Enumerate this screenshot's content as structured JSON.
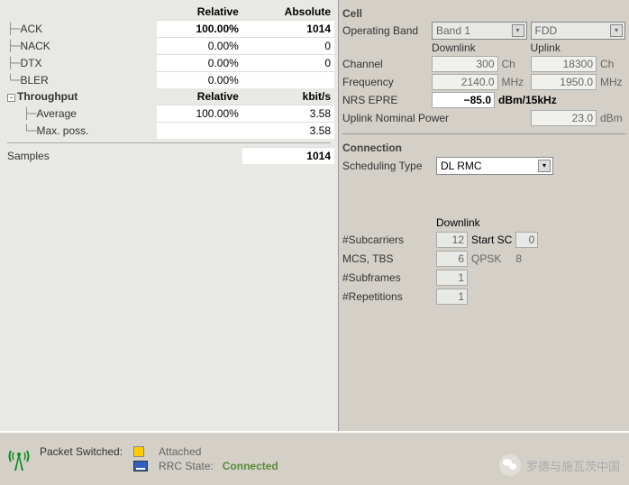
{
  "left": {
    "headers": {
      "relative": "Relative",
      "absolute": "Absolute"
    },
    "rows": {
      "ack": {
        "label": "ACK",
        "rel": "100.00%",
        "abs": "1014"
      },
      "nack": {
        "label": "NACK",
        "rel": "0.00%",
        "abs": "0"
      },
      "dtx": {
        "label": "DTX",
        "rel": "0.00%",
        "abs": "0"
      },
      "bler": {
        "label": "BLER",
        "rel": "0.00%"
      }
    },
    "throughput": {
      "label": "Throughput",
      "headers": {
        "relative": "Relative",
        "unit": "kbit/s"
      },
      "average": {
        "label": "Average",
        "rel": "100.00%",
        "val": "3.58"
      },
      "maxposs": {
        "label": "Max. poss.",
        "val": "3.58"
      }
    },
    "samples": {
      "label": "Samples",
      "val": "1014"
    }
  },
  "cell": {
    "title": "Cell",
    "operating_band": {
      "label": "Operating Band",
      "band": "Band 1",
      "duplex": "FDD"
    },
    "col_headers": {
      "dl": "Downlink",
      "ul": "Uplink"
    },
    "channel": {
      "label": "Channel",
      "dl": "300",
      "ul": "18300",
      "unit": "Ch"
    },
    "frequency": {
      "label": "Frequency",
      "dl": "2140.0",
      "ul": "1950.0",
      "unit": "MHz"
    },
    "nrs_epre": {
      "label": "NRS EPRE",
      "val": "−85.0",
      "unit": "dBm/15kHz"
    },
    "ul_power": {
      "label": "Uplink Nominal Power",
      "val": "23.0",
      "unit": "dBm"
    }
  },
  "connection": {
    "title": "Connection",
    "sched_type": {
      "label": "Scheduling Type",
      "val": "DL RMC"
    },
    "col_header": "Downlink",
    "subcarriers": {
      "label": "#Subcarriers",
      "val": "12",
      "startsc_label": "Start SC",
      "startsc_val": "0"
    },
    "mcs_tbs": {
      "label": "MCS, TBS",
      "val": "6",
      "mod": "QPSK",
      "tbs": "8"
    },
    "subframes": {
      "label": "#Subframes",
      "val": "1"
    },
    "repetitions": {
      "label": "#Repetitions",
      "val": "1"
    }
  },
  "status": {
    "packet_switched": "Packet Switched:",
    "attached": "Attached",
    "rrc_state": "RRC State:",
    "connected": "Connected"
  },
  "wechat": "罗德与施瓦茨中国"
}
